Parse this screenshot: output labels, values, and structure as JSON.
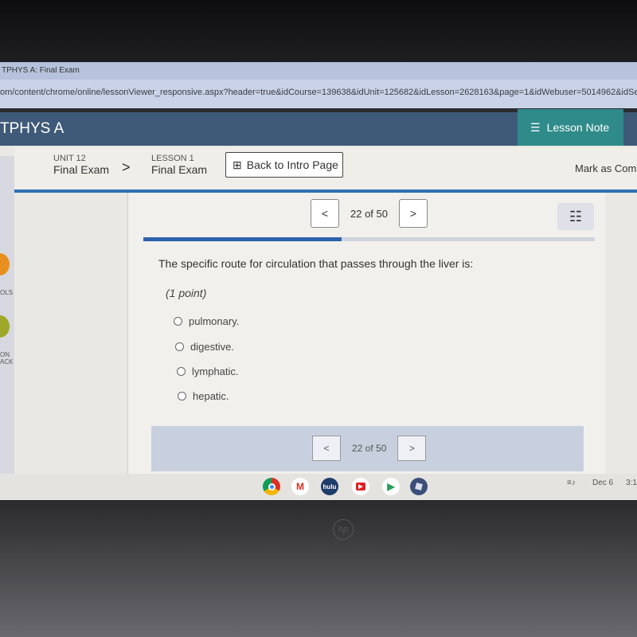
{
  "browser": {
    "tab_title": "TPHYS A: Final Exam",
    "url": "om/content/chrome/online/lessonViewer_responsive.aspx?header=true&idCourse=139638&idUnit=125682&idLesson=2628163&page=1&idWebuser=5014962&idSection=16"
  },
  "header": {
    "course": "TPHYS A",
    "lesson_note": "Lesson Note"
  },
  "nav": {
    "unit_label": "UNIT 12",
    "unit_name": "Final Exam",
    "lesson_label": "LESSON 1",
    "lesson_name": "Final Exam",
    "back_button": "Back to Intro Page",
    "mark_complete": "Mark as Comp"
  },
  "sidebar": {
    "tools_label": "OLS",
    "item2_line1": "ON",
    "item2_line2": "ACK"
  },
  "pager": {
    "prev": "<",
    "next": ">",
    "position": "22 of 50",
    "current": 22,
    "total": 50,
    "progress_percent": 44
  },
  "question": {
    "text": "The specific route for circulation that passes through the liver is:",
    "points": "(1 point)",
    "options": [
      "pulmonary.",
      "digestive.",
      "lymphatic.",
      "hepatic."
    ]
  },
  "taskbar": {
    "apps": [
      "chrome",
      "gmail",
      "hulu",
      "youtube",
      "play-store",
      "roblox"
    ],
    "hulu_label": "hulu",
    "date": "Dec 6",
    "time": "3:1"
  },
  "colors": {
    "header": "#3f5a78",
    "lesson_note": "#2f8b8a",
    "accent": "#2f6fb3"
  }
}
